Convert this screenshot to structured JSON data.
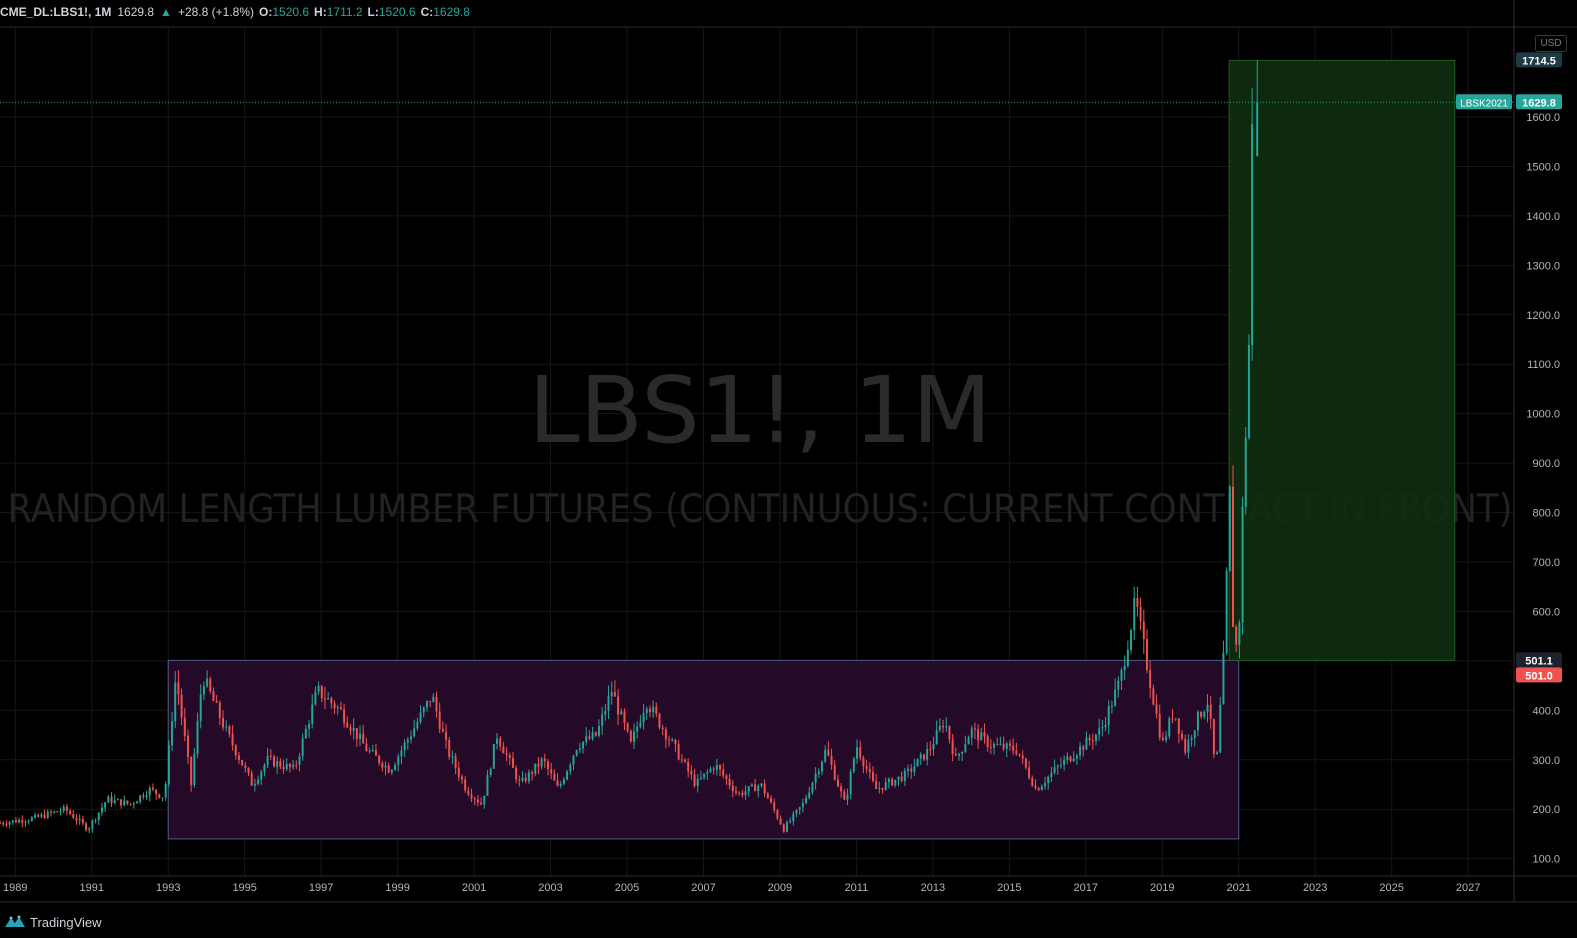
{
  "legend": {
    "symbol": "CME_DL:LBS1!, 1M",
    "last": "1629.8",
    "change": "+28.8 (+1.8%)",
    "open_label": "O:",
    "open": "1520.6",
    "high_label": "H:",
    "high": "1711.2",
    "low_label": "L:",
    "low": "1520.6",
    "close_label": "C:",
    "close": "1629.8"
  },
  "watermark": {
    "line1": "LBS1!, 1M",
    "line2": "RANDOM LENGTH LUMBER FUTURES (CONTINUOUS: CURRENT CONTRACT IN FRONT)"
  },
  "currency": "USD",
  "brand": "TradingView",
  "price_labels": {
    "high_marker": "1714.5",
    "last_symbol": "LBSK2021",
    "last_value": "1629.8",
    "box_top": "501.1",
    "box_bottom": "501.0"
  },
  "colors": {
    "up": "#26a69a",
    "down": "#ef5350",
    "range_box_fill": "#2a0b2f",
    "range_box_border": "#4a5d8a",
    "target_box_fill": "#0e2f10",
    "target_box_border": "#1e5a22",
    "grid": "#15171c",
    "axis_text": "#b2b5be"
  },
  "chart_data": {
    "type": "candlestick",
    "interval": "1M",
    "y_scale": "linear",
    "ylim": [
      65,
      1780
    ],
    "y_ticks": [
      100,
      200,
      300,
      400,
      500,
      600,
      700,
      800,
      900,
      1000,
      1100,
      1200,
      1300,
      1400,
      1500,
      1600
    ],
    "y_tick_labels": [
      "100.0",
      "200.0",
      "300.0",
      "400.0",
      "500.0",
      "600.0",
      "700.0",
      "800.0",
      "900.0",
      "1000.0",
      "1100.0",
      "1200.0",
      "1300.0",
      "1400.0",
      "1500.0",
      "1600.0"
    ],
    "xlim": [
      1988.6,
      2028.2
    ],
    "x_ticks": [
      1989,
      1991,
      1993,
      1995,
      1997,
      1999,
      2001,
      2003,
      2005,
      2007,
      2009,
      2011,
      2013,
      2015,
      2017,
      2019,
      2021,
      2023,
      2025,
      2027
    ],
    "x_tick_labels": [
      "1989",
      "1991",
      "1993",
      "1995",
      "1997",
      "1999",
      "2001",
      "2003",
      "2005",
      "2007",
      "2009",
      "2011",
      "2013",
      "2015",
      "2017",
      "2019",
      "2021",
      "2023",
      "2025",
      "2027"
    ],
    "grid": true,
    "anchors": [
      [
        1988.6,
        172
      ],
      [
        1989.5,
        182
      ],
      [
        1990.3,
        200
      ],
      [
        1990.9,
        160
      ],
      [
        1991.4,
        220
      ],
      [
        1992.0,
        210
      ],
      [
        1992.5,
        240
      ],
      [
        1992.9,
        225
      ],
      [
        1993.2,
        470
      ],
      [
        1993.6,
        250
      ],
      [
        1993.9,
        470
      ],
      [
        1994.5,
        360
      ],
      [
        1995.2,
        250
      ],
      [
        1995.6,
        300
      ],
      [
        1996.3,
        280
      ],
      [
        1996.9,
        440
      ],
      [
        1997.5,
        400
      ],
      [
        1998.2,
        320
      ],
      [
        1998.8,
        280
      ],
      [
        1999.4,
        360
      ],
      [
        1999.9,
        430
      ],
      [
        2000.3,
        320
      ],
      [
        2000.8,
        240
      ],
      [
        2001.2,
        210
      ],
      [
        2001.6,
        350
      ],
      [
        2002.2,
        250
      ],
      [
        2002.8,
        300
      ],
      [
        2003.2,
        240
      ],
      [
        2003.7,
        330
      ],
      [
        2004.2,
        350
      ],
      [
        2004.6,
        440
      ],
      [
        2005.1,
        330
      ],
      [
        2005.5,
        420
      ],
      [
        2006.2,
        330
      ],
      [
        2006.8,
        250
      ],
      [
        2007.3,
        290
      ],
      [
        2007.9,
        230
      ],
      [
        2008.5,
        250
      ],
      [
        2009.1,
        160
      ],
      [
        2009.6,
        210
      ],
      [
        2010.2,
        320
      ],
      [
        2010.7,
        210
      ],
      [
        2011.0,
        330
      ],
      [
        2011.5,
        240
      ],
      [
        2012.3,
        270
      ],
      [
        2012.9,
        320
      ],
      [
        2013.3,
        380
      ],
      [
        2013.6,
        300
      ],
      [
        2014.0,
        360
      ],
      [
        2014.5,
        330
      ],
      [
        2015.2,
        320
      ],
      [
        2015.7,
        240
      ],
      [
        2016.2,
        280
      ],
      [
        2016.8,
        320
      ],
      [
        2017.4,
        360
      ],
      [
        2017.9,
        460
      ],
      [
        2018.3,
        620
      ],
      [
        2018.7,
        450
      ],
      [
        2019.0,
        330
      ],
      [
        2019.3,
        400
      ],
      [
        2019.6,
        320
      ],
      [
        2019.9,
        380
      ],
      [
        2020.2,
        420
      ],
      [
        2020.4,
        270
      ],
      [
        2020.6,
        500
      ],
      [
        2020.7,
        700
      ],
      [
        2020.8,
        900
      ],
      [
        2020.85,
        580
      ],
      [
        2020.95,
        520
      ],
      [
        2021.05,
        620
      ],
      [
        2021.1,
        800
      ],
      [
        2021.2,
        1000
      ],
      [
        2021.25,
        960
      ],
      [
        2021.3,
        1500
      ],
      [
        2021.4,
        1629.8
      ]
    ],
    "rect_purple": {
      "x1": 1993.0,
      "x2": 2021.0,
      "y1": 140,
      "y2": 501.1
    },
    "rect_green": {
      "x1": 2020.75,
      "x2": 2026.65,
      "y1": 501.1,
      "y2": 1714.5
    },
    "last_price": 1629.8,
    "high_price": 1714.5,
    "seed": 7
  }
}
